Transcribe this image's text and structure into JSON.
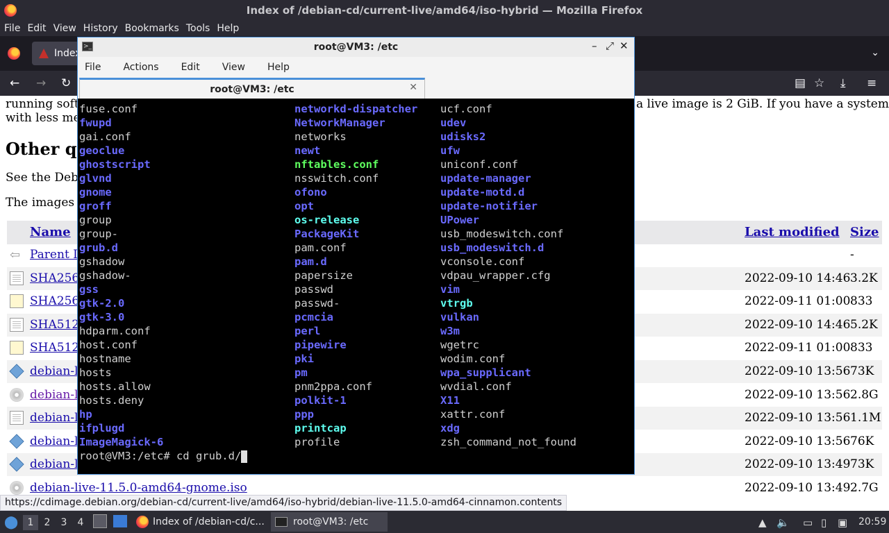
{
  "firefox": {
    "window_title": "Index of /debian-cd/current-live/amd64/iso-hybrid — Mozilla Firefox",
    "menu": [
      "File",
      "Edit",
      "View",
      "History",
      "Bookmarks",
      "Tools",
      "Help"
    ],
    "tab_label": "Index",
    "status_url": "https://cdimage.debian.org/debian-cd/current-live/amd64/iso-hybrid/debian-live-11.5.0-amd64-cinnamon.contents"
  },
  "page": {
    "line1": "running softw",
    "line1_right": "a live image is 2 GiB. If you have a system",
    "line2": "with less me",
    "heading": "Other q",
    "see_text": "See the Debi",
    "images_text": "The images l",
    "table": {
      "col_name": "Name",
      "col_modified": "Last modified",
      "col_size": "Size",
      "rows": [
        {
          "icon": "back-icon",
          "name": "Parent D",
          "date": "",
          "size": "-"
        },
        {
          "icon": "document-icon",
          "name": "SHA256",
          "date": "2022-09-10 14:46",
          "size": "3.2K"
        },
        {
          "icon": "signature-icon",
          "name": "SHA256",
          "date": "2022-09-11 01:00",
          "size": "833"
        },
        {
          "icon": "document-icon",
          "name": "SHA512",
          "date": "2022-09-10 14:46",
          "size": "5.2K"
        },
        {
          "icon": "signature-icon",
          "name": "SHA512",
          "date": "2022-09-11 01:00",
          "size": "833"
        },
        {
          "icon": "package-icon",
          "name": "debian-l",
          "date": "2022-09-10 13:56",
          "size": "73K"
        },
        {
          "icon": "disc-icon",
          "name": "debian-l",
          "date": "2022-09-10 13:56",
          "size": "2.8G",
          "visited": true
        },
        {
          "icon": "document-icon",
          "name": "debian-l",
          "date": "2022-09-10 13:56",
          "size": "1.1M"
        },
        {
          "icon": "package-icon",
          "name": "debian-l",
          "date": "2022-09-10 13:56",
          "size": "76K"
        },
        {
          "icon": "package-icon",
          "name": "debian-l",
          "date": "2022-09-10 13:49",
          "size": "73K"
        },
        {
          "icon": "disc-icon",
          "name": "debian-live-11.5.0-amd64-gnome.iso",
          "date": "2022-09-10 13:49",
          "size": "2.7G"
        }
      ]
    }
  },
  "terminal": {
    "title": "root@VM3: /etc",
    "menu": [
      "File",
      "Actions",
      "Edit",
      "View",
      "Help"
    ],
    "tab_label": "root@VM3: /etc",
    "columns": [
      [
        {
          "t": "fuse.conf",
          "k": "file"
        },
        {
          "t": "fwupd",
          "k": "dir"
        },
        {
          "t": "gai.conf",
          "k": "file"
        },
        {
          "t": "geoclue",
          "k": "dir"
        },
        {
          "t": "ghostscript",
          "k": "dir"
        },
        {
          "t": "glvnd",
          "k": "dir"
        },
        {
          "t": "gnome",
          "k": "dir"
        },
        {
          "t": "groff",
          "k": "dir"
        },
        {
          "t": "group",
          "k": "file"
        },
        {
          "t": "group-",
          "k": "file"
        },
        {
          "t": "grub.d",
          "k": "dir"
        },
        {
          "t": "gshadow",
          "k": "file"
        },
        {
          "t": "gshadow-",
          "k": "file"
        },
        {
          "t": "gss",
          "k": "dir"
        },
        {
          "t": "gtk-2.0",
          "k": "dir"
        },
        {
          "t": "gtk-3.0",
          "k": "dir"
        },
        {
          "t": "hdparm.conf",
          "k": "file"
        },
        {
          "t": "host.conf",
          "k": "file"
        },
        {
          "t": "hostname",
          "k": "file"
        },
        {
          "t": "hosts",
          "k": "file"
        },
        {
          "t": "hosts.allow",
          "k": "file"
        },
        {
          "t": "hosts.deny",
          "k": "file"
        },
        {
          "t": "hp",
          "k": "dir"
        },
        {
          "t": "ifplugd",
          "k": "dir"
        },
        {
          "t": "ImageMagick-6",
          "k": "dir"
        }
      ],
      [
        {
          "t": "networkd-dispatcher",
          "k": "dir"
        },
        {
          "t": "NetworkManager",
          "k": "dir"
        },
        {
          "t": "networks",
          "k": "file"
        },
        {
          "t": "newt",
          "k": "dir"
        },
        {
          "t": "nftables.conf",
          "k": "exec"
        },
        {
          "t": "nsswitch.conf",
          "k": "file"
        },
        {
          "t": "ofono",
          "k": "dir"
        },
        {
          "t": "opt",
          "k": "dir"
        },
        {
          "t": "os-release",
          "k": "link"
        },
        {
          "t": "PackageKit",
          "k": "dir"
        },
        {
          "t": "pam.conf",
          "k": "file"
        },
        {
          "t": "pam.d",
          "k": "dir"
        },
        {
          "t": "papersize",
          "k": "file"
        },
        {
          "t": "passwd",
          "k": "file"
        },
        {
          "t": "passwd-",
          "k": "file"
        },
        {
          "t": "pcmcia",
          "k": "dir"
        },
        {
          "t": "perl",
          "k": "dir"
        },
        {
          "t": "pipewire",
          "k": "dir"
        },
        {
          "t": "pki",
          "k": "dir"
        },
        {
          "t": "pm",
          "k": "dir"
        },
        {
          "t": "pnm2ppa.conf",
          "k": "file"
        },
        {
          "t": "polkit-1",
          "k": "dir"
        },
        {
          "t": "ppp",
          "k": "dir"
        },
        {
          "t": "printcap",
          "k": "link"
        },
        {
          "t": "profile",
          "k": "file"
        }
      ],
      [
        {
          "t": "ucf.conf",
          "k": "file"
        },
        {
          "t": "udev",
          "k": "dir"
        },
        {
          "t": "udisks2",
          "k": "dir"
        },
        {
          "t": "ufw",
          "k": "dir"
        },
        {
          "t": "uniconf.conf",
          "k": "file"
        },
        {
          "t": "update-manager",
          "k": "dir"
        },
        {
          "t": "update-motd.d",
          "k": "dir"
        },
        {
          "t": "update-notifier",
          "k": "dir"
        },
        {
          "t": "UPower",
          "k": "dir"
        },
        {
          "t": "usb_modeswitch.conf",
          "k": "file"
        },
        {
          "t": "usb_modeswitch.d",
          "k": "dir"
        },
        {
          "t": "vconsole.conf",
          "k": "file"
        },
        {
          "t": "vdpau_wrapper.cfg",
          "k": "file"
        },
        {
          "t": "vim",
          "k": "dir"
        },
        {
          "t": "vtrgb",
          "k": "link"
        },
        {
          "t": "vulkan",
          "k": "dir"
        },
        {
          "t": "w3m",
          "k": "dir"
        },
        {
          "t": "wgetrc",
          "k": "file"
        },
        {
          "t": "wodim.conf",
          "k": "file"
        },
        {
          "t": "wpa_supplicant",
          "k": "dir"
        },
        {
          "t": "wvdial.conf",
          "k": "file"
        },
        {
          "t": "X11",
          "k": "dir"
        },
        {
          "t": "xattr.conf",
          "k": "file"
        },
        {
          "t": "xdg",
          "k": "dir"
        },
        {
          "t": "zsh_command_not_found",
          "k": "file"
        }
      ]
    ],
    "prompt": "root@VM3:/etc# cd grub.d/"
  },
  "taskbar": {
    "workspaces": [
      "1",
      "2",
      "3",
      "4"
    ],
    "apps": [
      {
        "label": "Index of /debian-cd/c...",
        "icon": "firefox-icon"
      },
      {
        "label": "root@VM3: /etc",
        "icon": "terminal-icon"
      }
    ],
    "clock": "20:59"
  },
  "colors": {
    "dir": "#6a6aff",
    "exec": "#5fff5f",
    "link": "#5ffff0",
    "accent": "#4a90d9"
  }
}
